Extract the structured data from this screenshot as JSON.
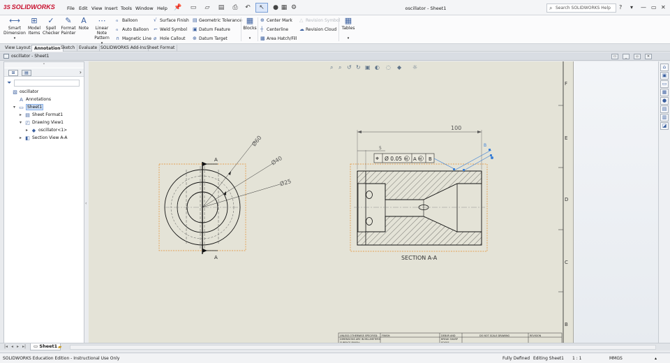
{
  "app": {
    "logo": "SOLIDWORKS",
    "logo_mark": "3S",
    "menu": [
      "File",
      "Edit",
      "View",
      "Insert",
      "Tools",
      "Window",
      "Help"
    ],
    "document_title": "oscillator - Sheet1",
    "search_placeholder": "Search SOLIDWORKS Help",
    "help_label": "?"
  },
  "ribbon": {
    "big": [
      {
        "label1": "Smart",
        "label2": "Dimension",
        "icon": "smart-dimension-icon"
      },
      {
        "label1": "Model",
        "label2": "Items",
        "icon": "model-items-icon"
      },
      {
        "label1": "Spell",
        "label2": "Checker",
        "icon": "spell-checker-icon"
      },
      {
        "label1": "Format",
        "label2": "Painter",
        "icon": "format-painter-icon"
      },
      {
        "label1": "Note",
        "label2": "",
        "icon": "note-icon"
      },
      {
        "label1": "Linear Note",
        "label2": "Pattern",
        "icon": "linear-note-pattern-icon"
      }
    ],
    "col1": [
      "Balloon",
      "Auto Balloon",
      "Magnetic Line"
    ],
    "col2": [
      "Surface Finish",
      "Weld Symbol",
      "Hole Callout"
    ],
    "col3": [
      "Geometric Tolerance",
      "Datum Feature",
      "Datum Target"
    ],
    "blocks": "Blocks",
    "col4": [
      "Center Mark",
      "Centerline",
      "Area Hatch/Fill"
    ],
    "col5": [
      "Revision Symbol",
      "Revision Cloud"
    ],
    "tables": "Tables"
  },
  "tabs": [
    "View Layout",
    "Annotation",
    "Sketch",
    "Evaluate",
    "SOLIDWORKS Add-Ins",
    "Sheet Format"
  ],
  "active_tab": "Annotation",
  "document_window": {
    "title": "oscillator - Sheet1"
  },
  "feature_tree": [
    {
      "label": "oscillator",
      "depth": 0,
      "toggle": "",
      "icon": "drawing-icon"
    },
    {
      "label": "Annotations",
      "depth": 1,
      "toggle": "",
      "icon": "annotations-icon"
    },
    {
      "label": "Sheet1",
      "depth": 1,
      "toggle": "▾",
      "icon": "sheet-icon",
      "selected": true
    },
    {
      "label": "Sheet Format1",
      "depth": 2,
      "toggle": "▸",
      "icon": "sheet-format-icon"
    },
    {
      "label": "Drawing View1",
      "depth": 2,
      "toggle": "▾",
      "icon": "drawing-view-icon"
    },
    {
      "label": "oscillator<1>",
      "depth": 3,
      "toggle": "▸",
      "icon": "part-icon"
    },
    {
      "label": "Section View A-A",
      "depth": 2,
      "toggle": "▸",
      "icon": "section-view-icon"
    }
  ],
  "drawing": {
    "border_letters": [
      "F",
      "E",
      "D",
      "C",
      "B"
    ],
    "front_view": {
      "dimensions": [
        "Ø60",
        "Ø40",
        "Ø25"
      ],
      "section_labels": [
        "A",
        "A"
      ]
    },
    "section_view": {
      "caption": "SECTION A-A",
      "length_dim": "100",
      "small_dim": "5",
      "tolerance": {
        "symbol": "⌖",
        "value": "Ø 0.05",
        "modifier": "M",
        "datum1": "A",
        "datum1_mod": "M",
        "datum2": "B"
      },
      "note_flag": "B"
    },
    "title_block": {
      "notes": [
        "UNLESS OTHERWISE SPECIFIED:",
        "DIMENSIONS ARE IN MILLIMETERS",
        "SURFACE FINISH:"
      ],
      "finish": "FINISH:",
      "drawn": "DEBUR AND",
      "break": "BREAK SHARP",
      "edges": "EDGES",
      "do_not_scale": "DO NOT SCALE DRAWING",
      "revision": "REVISION"
    }
  },
  "sheet_tabs": {
    "active": "Sheet1"
  },
  "status": {
    "edition": "SOLIDWORKS Education Edition - Instructional Use Only",
    "state": "Fully Defined",
    "editing": "Editing Sheet1",
    "scale": "1 : 1",
    "units": "MMGS"
  },
  "colors": {
    "brand": "#c8102e",
    "sheet_bg": "#e4e3d7",
    "bounding_box": "#e48a2a",
    "selection": "#3a7fd6"
  }
}
